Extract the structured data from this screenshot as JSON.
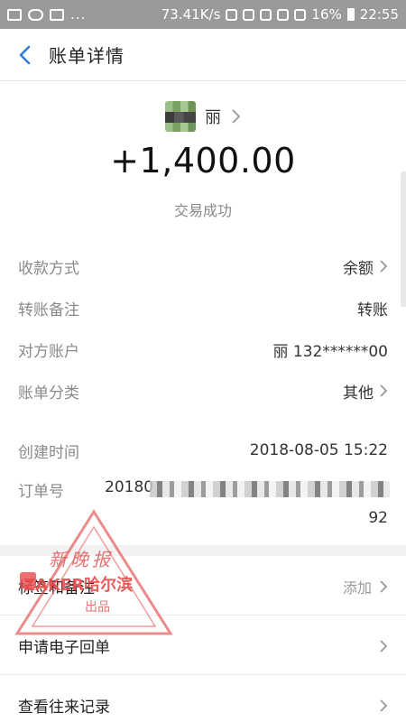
{
  "status_bar": {
    "speed": "73.41K/s",
    "battery": "16%",
    "time": "22:55"
  },
  "nav": {
    "title": "账单详情"
  },
  "summary": {
    "name": "丽",
    "amount": "+1,400.00",
    "status": "交易成功"
  },
  "details": {
    "rows": [
      {
        "label": "收款方式",
        "value": "余额"
      },
      {
        "label": "转账备注",
        "value": "转账"
      },
      {
        "label": "对方账户",
        "value": "丽 132******00"
      },
      {
        "label": "账单分类",
        "value": "其他"
      },
      {
        "label": "创建时间",
        "value": "2018-08-05 15:22"
      }
    ],
    "order": {
      "label": "订单号",
      "prefix": "20180",
      "suffix": "92"
    }
  },
  "actions": [
    {
      "label": "标签和备注",
      "hint": "添加"
    },
    {
      "label": "申请电子回单",
      "hint": ""
    },
    {
      "label": "查看往来记录",
      "hint": ""
    }
  ],
  "watermark": {
    "title": "新晚报",
    "brand": "ZAKER哈尔滨",
    "sub": "出品"
  },
  "colors": {
    "accent": "#2f7ed8",
    "watermark": "#e84c4c"
  },
  "icons": [
    "back-icon",
    "chevron-right-icon"
  ]
}
